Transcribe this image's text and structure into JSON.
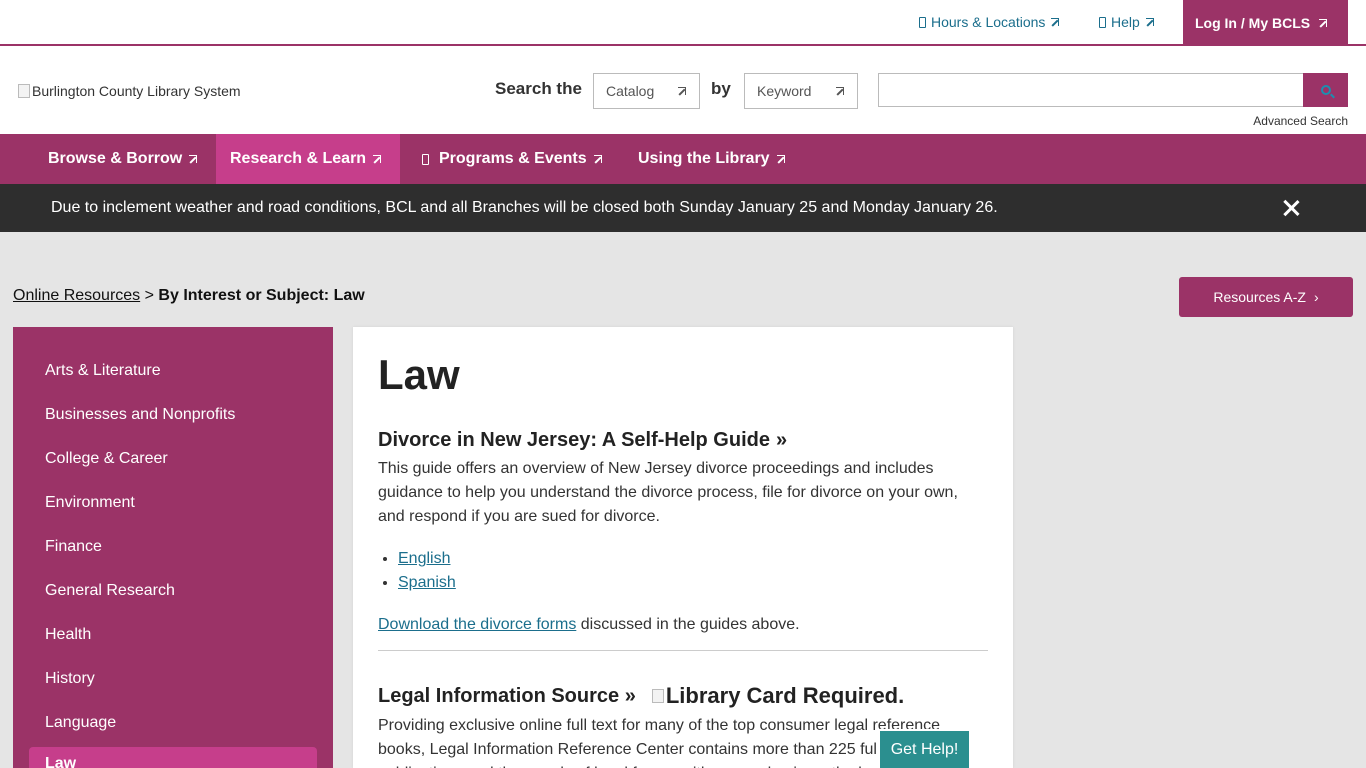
{
  "topbar": {
    "hours": "Hours & Locations",
    "help": "Help",
    "login": "Log In / My BCLS"
  },
  "header": {
    "logo_alt": "Burlington County Library System",
    "search_label": "Search the",
    "scope_value": "Catalog",
    "by_label": "by",
    "type_value": "Keyword",
    "search_placeholder": "",
    "advanced": "Advanced Search"
  },
  "nav": {
    "items": [
      {
        "label": "Browse & Borrow"
      },
      {
        "label": "Research & Learn"
      },
      {
        "label": "Programs & Events"
      },
      {
        "label": "Using the Library"
      }
    ]
  },
  "alert": {
    "text": "Due to inclement weather and road conditions, BCL and all Branches will be closed both Sunday January 25 and Monday January 26."
  },
  "breadcrumb": {
    "parent": "Online Resources",
    "separator": ">",
    "current": "By Interest or Subject: Law"
  },
  "az_button": "Resources A-Z",
  "sidebar": {
    "items": [
      "Arts & Literature",
      "Businesses and Nonprofits",
      "College & Career",
      "Environment",
      "Finance",
      "General Research",
      "Health",
      "History",
      "Language",
      "Law"
    ]
  },
  "main": {
    "title": "Law",
    "resource1": {
      "title": "Divorce in New Jersey: A Self-Help Guide",
      "description": "This guide offers an overview of New Jersey divorce proceedings and includes guidance to help you understand the divorce process, file for divorce on your own, and respond if you are sued for divorce.",
      "links": [
        "English",
        "Spanish"
      ],
      "forms_link": "Download the divorce forms",
      "forms_suffix": " discussed in the guides above."
    },
    "resource2": {
      "title": "Legal Information Source",
      "badge_alt": "Library Card Required.",
      "description": "Providing exclusive online full text for many of the top consumer legal reference books, Legal Information Reference Center contains more than 225 full text publications and thousands of legal forms, with an emphasis on the legal needs"
    }
  },
  "get_help": "Get Help!",
  "colors": {
    "brand": "#9b3367",
    "brand_active": "#c63e8b",
    "link": "#1b6e8c",
    "alert_bg": "#2e2e2e",
    "help_btn": "#2b8f8f"
  }
}
